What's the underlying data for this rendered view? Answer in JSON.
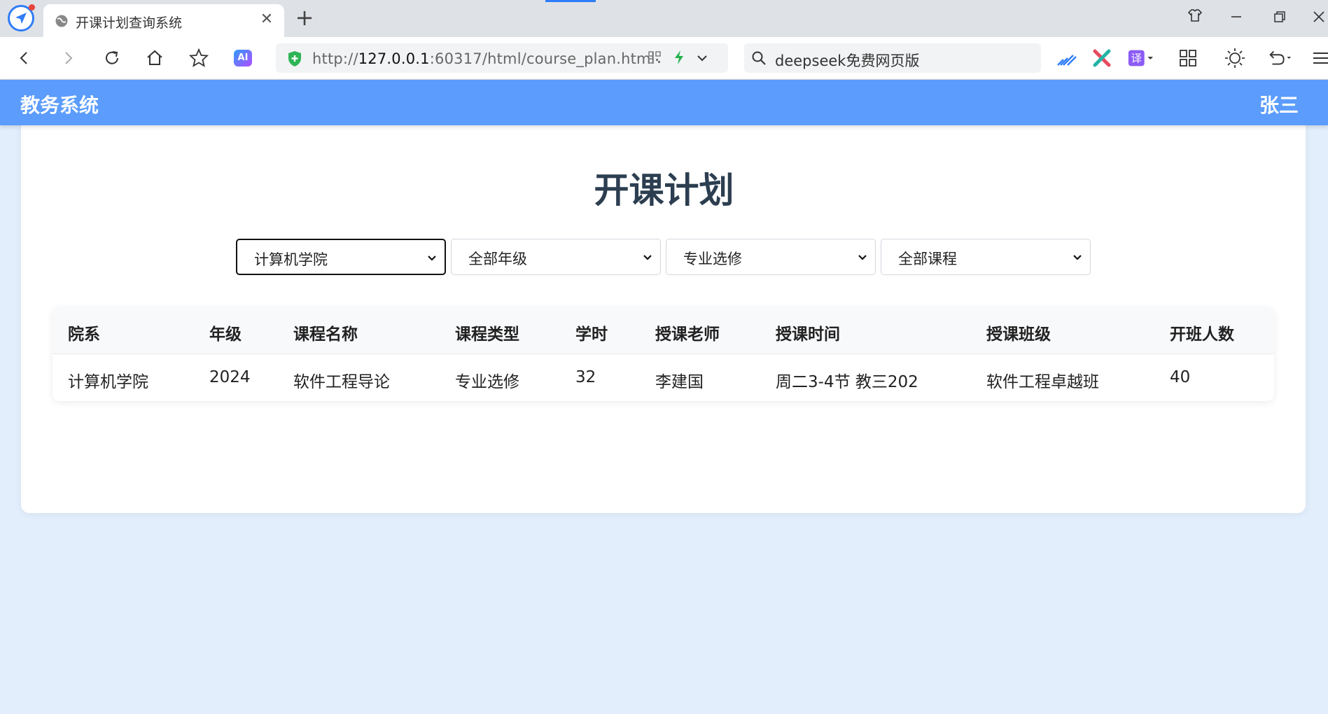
{
  "browser": {
    "tab_title": "开课计划查询系统",
    "tab_close": "✕",
    "new_tab": "+",
    "url_prefix": "http://",
    "url_host": "127.0.0.1",
    "url_rest": ":60317/html/course_plan.html",
    "search_text": "deepseek免费网页版",
    "accent_color": "#2f7df6"
  },
  "navbar": {
    "brand": "教务系统",
    "user": "张三",
    "color": "#5b9cfc"
  },
  "main": {
    "title": "开课计划",
    "filters": [
      {
        "value": "计算机学院"
      },
      {
        "value": "全部年级"
      },
      {
        "value": "专业选修"
      },
      {
        "value": "全部课程"
      }
    ],
    "table": {
      "headers": [
        "院系",
        "年级",
        "课程名称",
        "课程类型",
        "学时",
        "授课老师",
        "授课时间",
        "授课班级",
        "开班人数"
      ],
      "rows": [
        [
          "计算机学院",
          "2024",
          "软件工程导论",
          "专业选修",
          "32",
          "李建国",
          "周二3-4节 教三202",
          "软件工程卓越班",
          "40"
        ]
      ]
    }
  }
}
